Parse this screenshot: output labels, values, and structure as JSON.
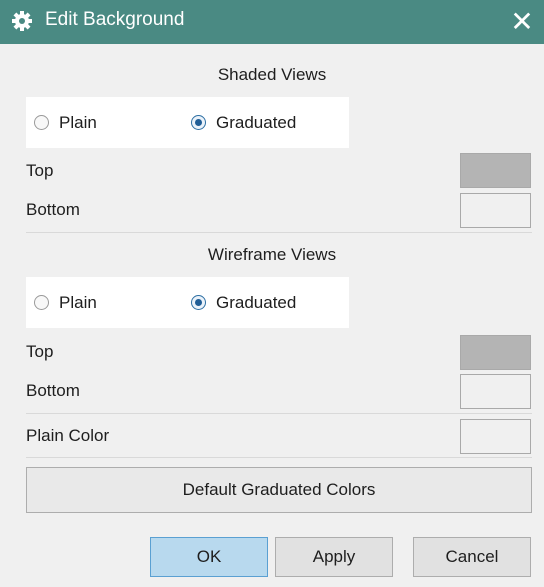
{
  "dialog": {
    "title": "Edit Background",
    "icon": "gear-icon",
    "close_glyph": "✕"
  },
  "shaded": {
    "heading": "Shaded Views",
    "options": [
      {
        "label": "Plain",
        "selected": false
      },
      {
        "label": "Graduated",
        "selected": true
      }
    ],
    "top_label": "Top",
    "bottom_label": "Bottom",
    "top_color": "#b4b4b4",
    "bottom_color": "#f0f0f0"
  },
  "wireframe": {
    "heading": "Wireframe Views",
    "options": [
      {
        "label": "Plain",
        "selected": false
      },
      {
        "label": "Graduated",
        "selected": true
      }
    ],
    "top_label": "Top",
    "bottom_label": "Bottom",
    "top_color": "#b4b4b4",
    "bottom_color": "#f0f0f0"
  },
  "plain_color": {
    "label": "Plain Color",
    "color": "#f0f0f0"
  },
  "buttons": {
    "default_colors": "Default Graduated Colors",
    "ok": "OK",
    "apply": "Apply",
    "cancel": "Cancel"
  }
}
